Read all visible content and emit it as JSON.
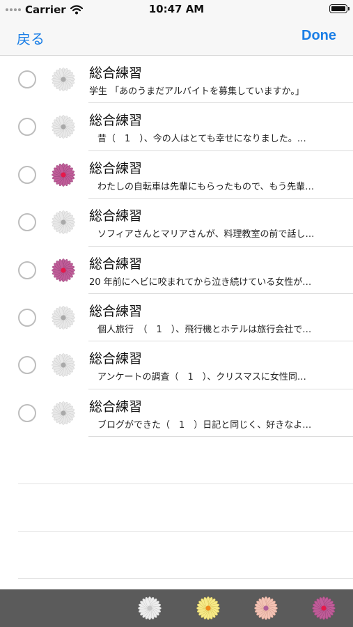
{
  "status_bar": {
    "carrier": "Carrier",
    "time": "10:47 AM"
  },
  "nav": {
    "back_label": "戻る",
    "done_label": "Done"
  },
  "items": [
    {
      "title": "総合練習",
      "subtitle": "学生 「あのうまだアルバイトを募集していますか。」",
      "flower": "gray-flower-icon"
    },
    {
      "title": "総合練習",
      "subtitle": "昔（　1　）、今の人はとても幸せになりました。…",
      "flower": "gray-flower-icon"
    },
    {
      "title": "総合練習",
      "subtitle": "わたしの自転車は先輩にもらったもので、もう先輩…",
      "flower": "pink-flower-icon"
    },
    {
      "title": "総合練習",
      "subtitle": "ソフィアさんとマリアさんが、料理教室の前で話し…",
      "flower": "gray-flower-icon"
    },
    {
      "title": "総合練習",
      "subtitle": "20 年前にヘビに咬まれてから泣き続けている女性が…",
      "flower": "pink-flower-icon"
    },
    {
      "title": "総合練習",
      "subtitle": "個人旅行　（　1　）、飛行機とホテルは旅行会社で…",
      "flower": "gray-flower-icon"
    },
    {
      "title": "総合練習",
      "subtitle": "アンケートの調査（　1　）、クリスマスに女性同…",
      "flower": "gray-flower-icon"
    },
    {
      "title": "総合練習",
      "subtitle": "ブログができた（　1　）日記と同じく、好きなよ…",
      "flower": "gray-flower-icon"
    }
  ],
  "toolbar": {
    "filters": [
      {
        "icon": "white-flower-icon",
        "color": "#eeeeee"
      },
      {
        "icon": "yellow-flower-icon",
        "color": "#f7ea8a"
      },
      {
        "icon": "peach-flower-icon",
        "color": "#f3c3b5"
      },
      {
        "icon": "pink-flower-icon",
        "color": "#c05d99"
      }
    ]
  },
  "colors": {
    "accent": "#1a7ee6",
    "flower_gray": "#e9e9e9",
    "flower_pink": "#c05d99",
    "toolbar_bg": "#5b5b5b"
  }
}
